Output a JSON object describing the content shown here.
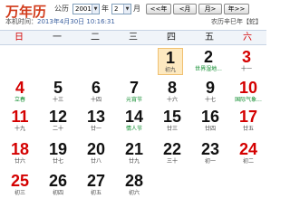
{
  "header": {
    "logo": "万年历",
    "system_label": "公历",
    "year_value": "2001",
    "year_unit": "年",
    "month_value": "2",
    "month_unit": "月",
    "prev_year": "<<年",
    "prev_month": "<月",
    "next_month": "月>",
    "next_year": "年>>",
    "now_label": "本机时间：",
    "now_value": "2013年4月30日 10:16:31",
    "lunar_info": "农历辛巳年【蛇】"
  },
  "weekdays": [
    "日",
    "一",
    "二",
    "三",
    "四",
    "五",
    "六"
  ],
  "days": [
    {
      "n": "1",
      "s": "初九"
    },
    {
      "n": "2",
      "s": "世界湿地..."
    },
    {
      "n": "3",
      "s": "十一"
    },
    {
      "n": "4",
      "s": "立春"
    },
    {
      "n": "5",
      "s": "十三"
    },
    {
      "n": "6",
      "s": "十四"
    },
    {
      "n": "7",
      "s": "元宵节"
    },
    {
      "n": "8",
      "s": "十六"
    },
    {
      "n": "9",
      "s": "十七"
    },
    {
      "n": "10",
      "s": "国际气象..."
    },
    {
      "n": "11",
      "s": "十九"
    },
    {
      "n": "12",
      "s": "二十"
    },
    {
      "n": "13",
      "s": "廿一"
    },
    {
      "n": "14",
      "s": "情人节"
    },
    {
      "n": "15",
      "s": "廿三"
    },
    {
      "n": "16",
      "s": "廿四"
    },
    {
      "n": "17",
      "s": "廿五"
    },
    {
      "n": "18",
      "s": "廿六"
    },
    {
      "n": "19",
      "s": "廿七"
    },
    {
      "n": "20",
      "s": "廿八"
    },
    {
      "n": "21",
      "s": "廿九"
    },
    {
      "n": "22",
      "s": "三十"
    },
    {
      "n": "23",
      "s": "初一"
    },
    {
      "n": "24",
      "s": "初二"
    },
    {
      "n": "25",
      "s": "初三"
    },
    {
      "n": "26",
      "s": "初四"
    },
    {
      "n": "27",
      "s": "初五"
    },
    {
      "n": "28",
      "s": "初六"
    }
  ]
}
